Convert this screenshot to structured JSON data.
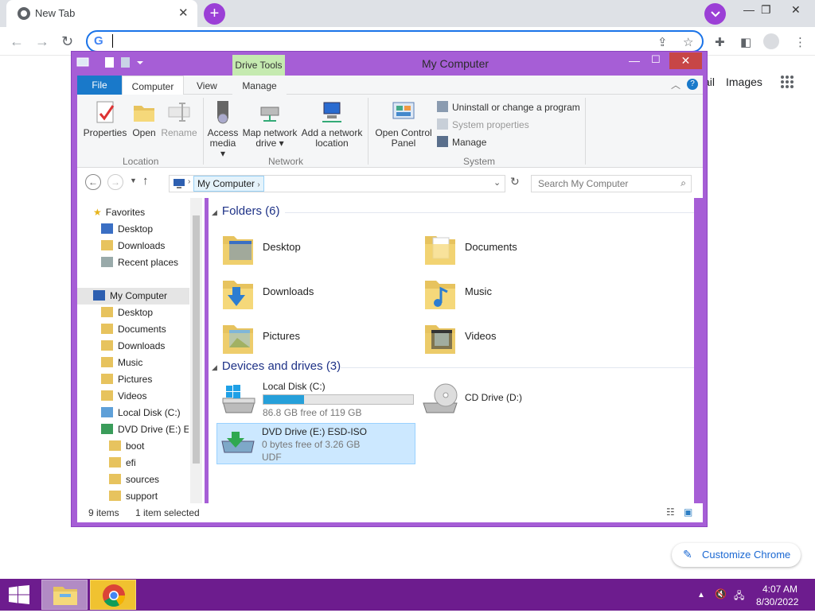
{
  "browser": {
    "tab_title": "New Tab",
    "tab_close": "✕",
    "newtab_label": "+",
    "tabsearch_label": "⌄",
    "address_value": "",
    "gmail_link": "ail",
    "images_link": "Images",
    "customize_label": "Customize Chrome",
    "win_min": "—",
    "win_max": "❐",
    "win_close": "✕"
  },
  "explorer": {
    "title": "My Computer",
    "context_tab": "Drive Tools",
    "tabs": {
      "file": "File",
      "computer": "Computer",
      "view": "View",
      "manage": "Manage"
    },
    "ribbon": {
      "properties": "Properties",
      "open": "Open",
      "rename": "Rename",
      "location_group": "Location",
      "access_media_1": "Access",
      "access_media_2": "media ▾",
      "map_drive_1": "Map network",
      "map_drive_2": "drive ▾",
      "add_location_1": "Add a network",
      "add_location_2": "location",
      "network_group": "Network",
      "open_cp_1": "Open Control",
      "open_cp_2": "Panel",
      "uninstall": "Uninstall or change a program",
      "system_properties": "System properties",
      "manage": "Manage",
      "system_group": "System"
    },
    "address": {
      "crumb": "My Computer",
      "search_placeholder": "Search My Computer"
    },
    "nav": {
      "favorites": "Favorites",
      "fav_desktop": "Desktop",
      "fav_downloads": "Downloads",
      "fav_recent": "Recent places",
      "mycomputer": "My Computer",
      "desktop": "Desktop",
      "documents": "Documents",
      "downloads": "Downloads",
      "music": "Music",
      "pictures": "Pictures",
      "videos": "Videos",
      "localdisk": "Local Disk (C:)",
      "dvd": "DVD Drive (E:) ES",
      "boot": "boot",
      "efi": "efi",
      "sources": "sources",
      "support": "support"
    },
    "folders_header": "Folders (6)",
    "folders": [
      "Desktop",
      "Documents",
      "Downloads",
      "Music",
      "Pictures",
      "Videos"
    ],
    "devices_header": "Devices and drives (3)",
    "drives": {
      "c_name": "Local Disk (C:)",
      "c_free": "86.8 GB free of 119 GB",
      "c_used_fraction": 0.27,
      "d_name": "CD Drive (D:)",
      "e_name": "DVD Drive (E:) ESD-ISO",
      "e_free": "0 bytes free of 3.26 GB",
      "e_fs": "UDF"
    },
    "status": {
      "items": "9 items",
      "selected": "1 item selected"
    }
  },
  "taskbar": {
    "time": "4:07 AM",
    "date": "8/30/2022"
  },
  "colors": {
    "accent": "#9b3fd6",
    "window_frame": "#a65ed6",
    "taskbar": "#6d1c8e",
    "file_tab": "#1979ca"
  }
}
